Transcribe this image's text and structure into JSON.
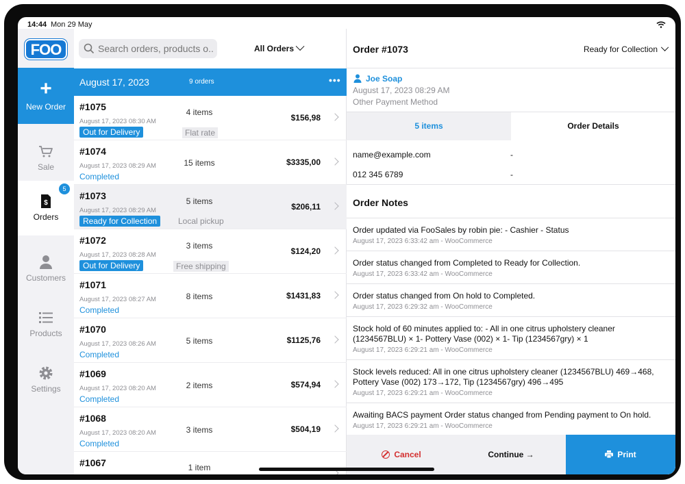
{
  "status_bar": {
    "time": "14:44",
    "date": "Mon 29 May"
  },
  "sidebar": {
    "logo": "FOO",
    "new_order": "New Order",
    "items": [
      {
        "label": "Sale",
        "icon": "cart-icon"
      },
      {
        "label": "Orders",
        "icon": "receipt-icon",
        "badge": "5"
      },
      {
        "label": "Customers",
        "icon": "person-icon"
      },
      {
        "label": "Products",
        "icon": "list-icon"
      },
      {
        "label": "Settings",
        "icon": "gear-icon"
      }
    ]
  },
  "list": {
    "search_placeholder": "Search orders, products o...",
    "filter": "All Orders",
    "day": {
      "date": "August 17, 2023",
      "count": "9 orders",
      "more": "•••"
    },
    "orders": [
      {
        "number": "#1075",
        "time": "August 17, 2023 08:30 AM",
        "status": "Out for Delivery",
        "items": "4 items",
        "shipping": "Flat rate",
        "total": "$156,98"
      },
      {
        "number": "#1074",
        "time": "August 17, 2023 08:29 AM",
        "status": "Completed",
        "items": "15 items",
        "shipping": "",
        "total": "$3335,00"
      },
      {
        "number": "#1073",
        "time": "August 17, 2023 08:29 AM",
        "status": "Ready for Collection",
        "items": "5 items",
        "shipping": "Local pickup",
        "total": "$206,11"
      },
      {
        "number": "#1072",
        "time": "August 17, 2023 08:28 AM",
        "status": "Out for Delivery",
        "items": "3 items",
        "shipping": "Free shipping",
        "total": "$124,20"
      },
      {
        "number": "#1071",
        "time": "August 17, 2023 08:27 AM",
        "status": "Completed",
        "items": "8 items",
        "shipping": "",
        "total": "$1431,83"
      },
      {
        "number": "#1070",
        "time": "August 17, 2023 08:26 AM",
        "status": "Completed",
        "items": "5 items",
        "shipping": "",
        "total": "$1125,76"
      },
      {
        "number": "#1069",
        "time": "August 17, 2023 08:20 AM",
        "status": "Completed",
        "items": "2 items",
        "shipping": "",
        "total": "$574,94"
      },
      {
        "number": "#1068",
        "time": "August 17, 2023 08:20 AM",
        "status": "Completed",
        "items": "3 items",
        "shipping": "",
        "total": "$504,19"
      },
      {
        "number": "#1067",
        "time": "",
        "status": "",
        "items": "1 item",
        "shipping": "",
        "total": ""
      }
    ]
  },
  "detail": {
    "title": "Order #1073",
    "status": "Ready for Collection",
    "customer": "Joe Soap",
    "date": "August 17, 2023 08:29 AM",
    "payment": "Other Payment Method",
    "tab_items": "5 items",
    "tab_details": "Order Details",
    "email": "name@example.com",
    "email_dash": "-",
    "phone": "012 345 6789",
    "phone_dash": "-",
    "notes_title": "Order Notes",
    "notes": [
      {
        "text": "Order updated via FooSales by robin pie: - Cashier - Status",
        "meta": "August 17, 2023 6:33:42 am - WooCommerce"
      },
      {
        "text": "Order status changed from Completed to Ready for Collection.",
        "meta": "August 17, 2023 6:33:42 am - WooCommerce"
      },
      {
        "text": "Order status changed from On hold to Completed.",
        "meta": "August 17, 2023 6:29:32 am - WooCommerce"
      },
      {
        "text": "Stock hold of 60 minutes applied to: - All in one citrus upholstery cleaner (1234567BLU) × 1- Pottery Vase (002) × 1- Tip (1234567gry) × 1",
        "meta": "August 17, 2023 6:29:21 am - WooCommerce"
      },
      {
        "text": "Stock levels reduced: All in one citrus upholstery cleaner (1234567BLU) 469→468, Pottery Vase (002) 173→172, Tip (1234567gry) 496→495",
        "meta": "August 17, 2023 6:29:21 am - WooCommerce"
      },
      {
        "text": "Awaiting BACS payment Order status changed from Pending payment to On hold.",
        "meta": "August 17, 2023 6:29:21 am - WooCommerce"
      }
    ],
    "cancel": "Cancel",
    "continue": "Continue →",
    "print": "Print"
  },
  "colors": {
    "accent": "#1e90dc",
    "danger": "#d32f2f",
    "muted": "#8e8e93"
  }
}
